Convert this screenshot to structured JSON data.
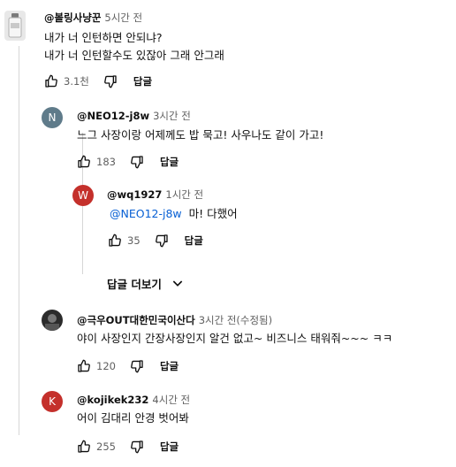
{
  "comments": [
    {
      "author": "@볼링사냥꾼",
      "time": "5시간 전",
      "lines": [
        "내가 너 인턴하면 안되냐?",
        "내가 너 인턴할수도 있잖아 그래 안그래"
      ],
      "likes": "3.1천",
      "reply_label": "답글",
      "avatar_icon": "bottle-image"
    },
    {
      "author": "@NEO12-j8w",
      "time": "3시간 전",
      "text": "느그 사장이랑 어제께도 밥 묵고! 사우나도 같이 가고!",
      "likes": "183",
      "reply_label": "답글",
      "avatar_letter": "N",
      "avatar_color": "#5f7b8a"
    },
    {
      "author": "@wq1927",
      "time": "1시간 전",
      "mention": "@NEO12-j8w",
      "text": "마! 다했어",
      "likes": "35",
      "reply_label": "답글",
      "avatar_letter": "W",
      "avatar_color": "#c4302b"
    },
    {
      "author": "@극우OUT대한민국이산다",
      "time": "3시간 전(수정됨)",
      "text": "야이 사장인지 간장사장인지 알건 없고~ 비즈니스 태워줘~~~  ㅋㅋ",
      "likes": "120",
      "reply_label": "답글",
      "avatar_icon": "dark-photo"
    },
    {
      "author": "@kojikek232",
      "time": "4시간 전",
      "text": "어이 김대리 안경 벗어봐",
      "likes": "255",
      "reply_label": "답글",
      "avatar_letter": "K",
      "avatar_color": "#c4302b"
    }
  ],
  "more_replies_label": "답글 더보기",
  "icons": {
    "like": "thumbs-up-icon",
    "dislike": "thumbs-down-icon",
    "expand": "chevron-down-icon"
  }
}
